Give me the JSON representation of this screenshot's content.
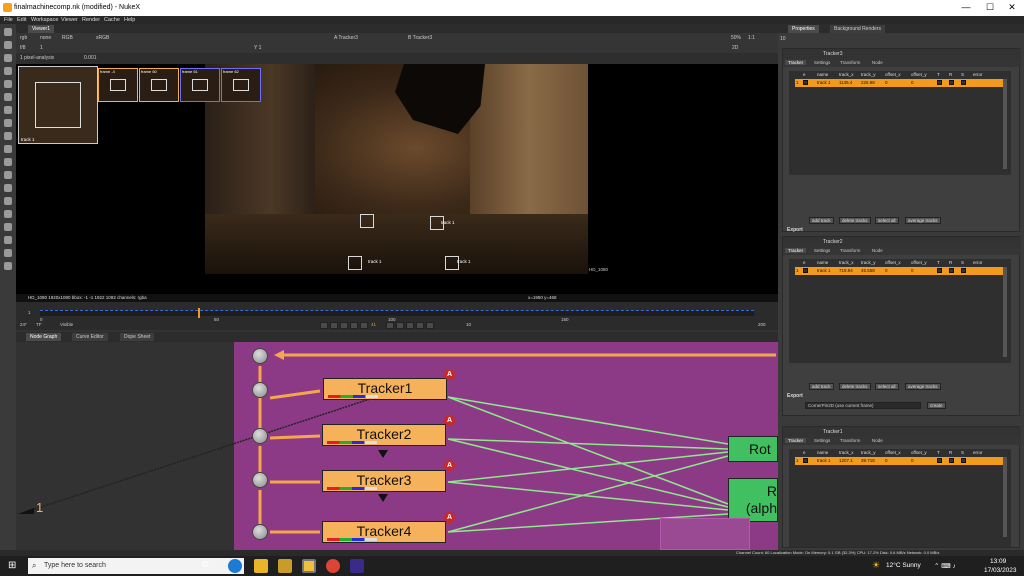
{
  "window": {
    "title": "finalmachinecomp.nk (modified) - NukeX",
    "min": "—",
    "max": "☐",
    "close": "✕"
  },
  "menu": [
    "File",
    "Edit",
    "Workspace",
    "Viewer",
    "Render",
    "Cache",
    "Help"
  ],
  "viewer": {
    "tab": "Viewer1",
    "channels": "rgb",
    "alpha": "none",
    "colorspace": "RGB",
    "lut": "sRGB",
    "input_a": "A Tracker3",
    "input_b": "B Tracker3",
    "fstop": "f/8",
    "frame_field": "1",
    "zoom": "50%",
    "ratio": "1:1",
    "view": "2D",
    "sub_control": "1 pixel-analysis",
    "gain": "0.001",
    "y_field": "Y 1",
    "format_label": "HD_1080",
    "status_left": "HD_1080 1920x1080  bbox: -1 -1 1922 1082 channels: rgba",
    "status_right": "x=1950 y=468",
    "track_labels": [
      "track 1",
      "track 1",
      "track 1",
      "track 1"
    ],
    "thumb_labels": [
      "track 1",
      "frame -4",
      "frame 60",
      "frame 61",
      "frame 62"
    ],
    "bigthumb_label": "track 1"
  },
  "timeline": {
    "ticks": [
      "0",
      "50",
      "100",
      "150"
    ],
    "current": "41",
    "start": "1",
    "end": "200",
    "fps": "24*",
    "tf": "TF",
    "mode": "Visible",
    "step": "10"
  },
  "node_graph": {
    "tabs": [
      "Node Graph",
      "Curve Editor",
      "Dope Sheet"
    ],
    "nodes": [
      "Tracker1",
      "Tracker2",
      "Tracker3",
      "Tracker4"
    ],
    "badge": "A",
    "right_nodes": [
      "Rot",
      "R",
      "(alph"
    ],
    "bottom_label": "1"
  },
  "properties": {
    "tabs": [
      "Properties",
      "Background Renders"
    ],
    "count": "10",
    "panels": [
      {
        "name": "Tracker3",
        "row": {
          "num": "1",
          "name": "track 1",
          "tx": "1145.4",
          "ty": "226.98",
          "ox": "0",
          "oy": "0"
        }
      },
      {
        "name": "Tracker2",
        "row": {
          "num": "1",
          "name": "track 1",
          "tx": "719.94",
          "ty": "45.558",
          "ox": "0",
          "oy": "0"
        }
      },
      {
        "name": "Tracker1",
        "row": {
          "num": "1",
          "name": "track 1",
          "tx": "1207.1",
          "ty": "39.718",
          "ox": "0",
          "oy": "0"
        }
      }
    ],
    "subtabs": [
      "Tracker",
      "Settings",
      "Transform",
      "Node"
    ],
    "headers": [
      "e",
      "name",
      "track_x",
      "track_y",
      "offset_x",
      "offset_y",
      "T",
      "R",
      "S",
      "error"
    ],
    "buttons": [
      "add track",
      "delete tracks",
      "select all",
      "average tracks"
    ],
    "export_label": "Export",
    "export_value": "CornerPin2D (use current frame)",
    "create": "create"
  },
  "status_bar": "Channel Count: 60  Localization Mode: On  Memory: 5.1 GB (32.3%)  CPU: 17.2%  Disk: 0.6 MB/s  Network: 0.0 MB/s",
  "taskbar": {
    "search_placeholder": "Type here to search",
    "weather": "12°C  Sunny",
    "time": "13:09",
    "date": "17/03/2023"
  }
}
